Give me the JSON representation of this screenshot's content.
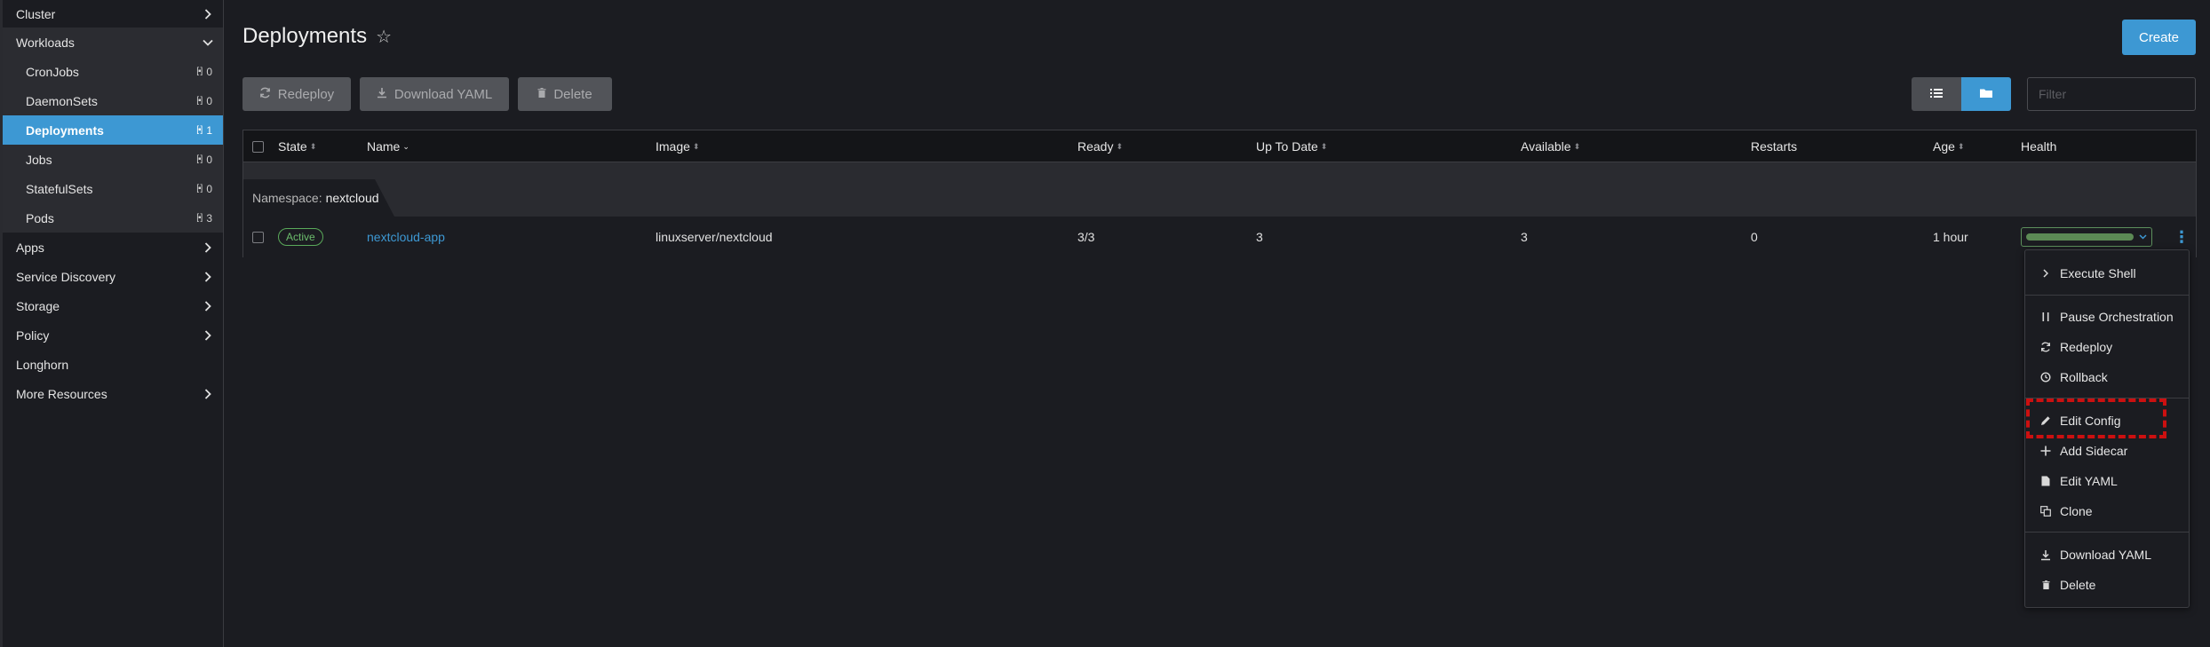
{
  "sidebar": {
    "cluster": "Cluster",
    "workloads": "Workloads",
    "workload_items": [
      {
        "label": "CronJobs",
        "count": "0"
      },
      {
        "label": "DaemonSets",
        "count": "0"
      },
      {
        "label": "Deployments",
        "count": "1"
      },
      {
        "label": "Jobs",
        "count": "0"
      },
      {
        "label": "StatefulSets",
        "count": "0"
      },
      {
        "label": "Pods",
        "count": "3"
      }
    ],
    "apps": "Apps",
    "service_discovery": "Service Discovery",
    "storage": "Storage",
    "policy": "Policy",
    "longhorn": "Longhorn",
    "more_resources": "More Resources"
  },
  "header": {
    "title": "Deployments",
    "create_label": "Create"
  },
  "toolbar": {
    "redeploy": "Redeploy",
    "download_yaml": "Download YAML",
    "delete": "Delete",
    "filter_placeholder": "Filter"
  },
  "table": {
    "columns": {
      "state": "State",
      "name": "Name",
      "image": "Image",
      "ready": "Ready",
      "up_to_date": "Up To Date",
      "available": "Available",
      "restarts": "Restarts",
      "age": "Age",
      "health": "Health"
    },
    "group": {
      "label": "Namespace:",
      "value": "nextcloud"
    },
    "row": {
      "state": "Active",
      "name": "nextcloud-app",
      "image": "linuxserver/nextcloud",
      "ready": "3/3",
      "up_to_date": "3",
      "available": "3",
      "restarts": "0",
      "age": "1 hour"
    }
  },
  "menu": {
    "execute_shell": "Execute Shell",
    "pause_orchestration": "Pause Orchestration",
    "redeploy": "Redeploy",
    "rollback": "Rollback",
    "edit_config": "Edit Config",
    "add_sidecar": "Add Sidecar",
    "edit_yaml": "Edit YAML",
    "clone": "Clone",
    "download_yaml": "Download YAML",
    "delete": "Delete"
  },
  "colors": {
    "accent": "#3d98d3",
    "active_badge": "#6cbd6c",
    "highlight": "#cc1010"
  }
}
